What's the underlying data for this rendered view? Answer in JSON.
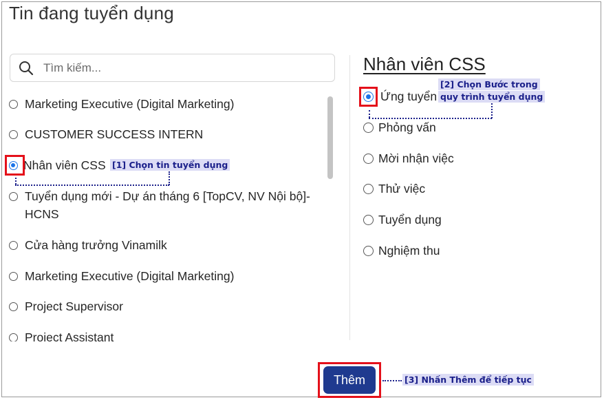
{
  "dialog": {
    "title": "Tin đang tuyển dụng"
  },
  "search": {
    "placeholder": "Tìm kiếm..."
  },
  "jobs": [
    {
      "label": "Marketing Executive (Digital Marketing)",
      "selected": false
    },
    {
      "label": "CUSTOMER SUCCESS INTERN",
      "selected": false
    },
    {
      "label": "Nhân viên CSS",
      "selected": true
    },
    {
      "label": "Tuyển dụng mới - Dự án tháng 6 [TopCV, NV Nội bộ]-",
      "label_line2": "HCNS",
      "selected": false
    },
    {
      "label": "Cửa hàng trưởng Vinamilk",
      "selected": false
    },
    {
      "label": "Marketing Executive (Digital Marketing)",
      "selected": false
    },
    {
      "label": "Project Supervisor",
      "selected": false
    },
    {
      "label": "Project Assistant",
      "selected": false
    }
  ],
  "panel": {
    "title": "Nhân viên CSS",
    "steps": [
      {
        "label": "Ứng tuyển",
        "selected": true
      },
      {
        "label": "Phỏng vấn",
        "selected": false
      },
      {
        "label": "Mời nhận việc",
        "selected": false
      },
      {
        "label": "Thử việc",
        "selected": false
      },
      {
        "label": "Tuyển dụng",
        "selected": false
      },
      {
        "label": "Nghiệm thu",
        "selected": false
      }
    ]
  },
  "annotations": {
    "step1": "[1] Chọn tin tuyển dụng",
    "step2_line1": "[2]  Chọn  Bước  trong",
    "step2_line2": "quy trình tuyển dụng",
    "step3": "[3] Nhấn Thêm để tiếp tục"
  },
  "actions": {
    "add_label": "Thêm"
  },
  "colors": {
    "accent": "#1a73e8",
    "button": "#1f3a8f",
    "highlight": "#e4101a",
    "callout_bg": "#dcdcf5",
    "callout_text": "#1a1f8a"
  }
}
